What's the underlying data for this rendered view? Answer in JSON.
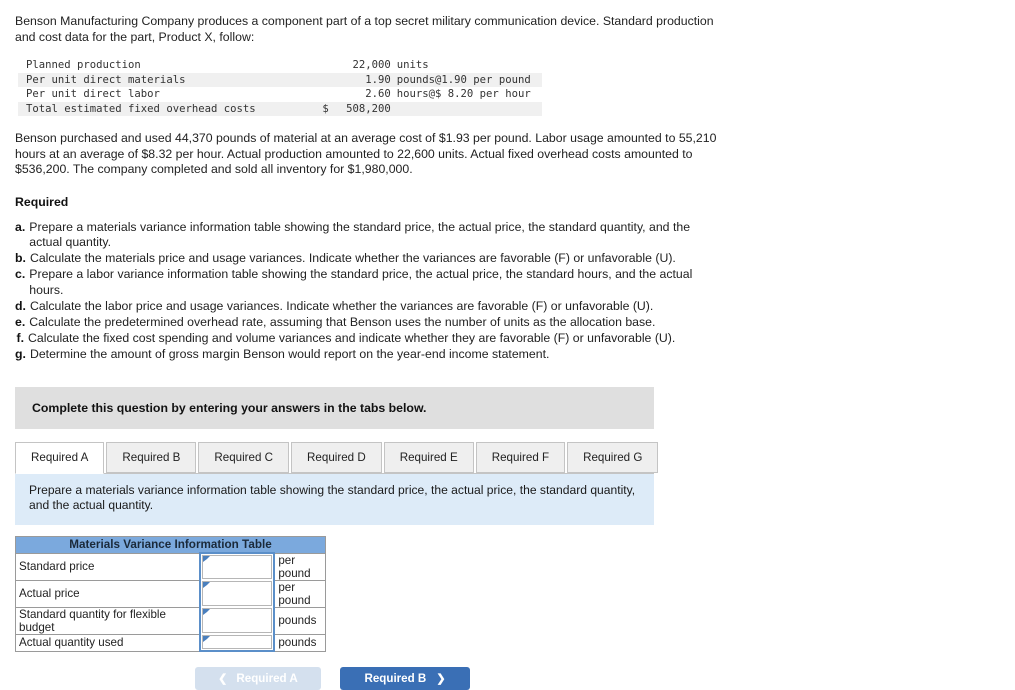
{
  "intro": {
    "paragraph1": "Benson Manufacturing Company produces a component part of a top secret military communication device. Standard production and cost data for the part, Product X, follow:",
    "paragraph2": "Benson purchased and used 44,370 pounds of material at an average cost of $1.93 per pound. Labor usage amounted to 55,210 hours at an average of $8.32 per hour. Actual production amounted to 22,600 units. Actual fixed overhead costs amounted to $536,200. The company completed and sold all inventory for $1,980,000."
  },
  "data_table": {
    "rows": [
      {
        "label": "Planned production",
        "dollar": "",
        "value": "22,000",
        "unit": "units"
      },
      {
        "label": "Per unit direct materials",
        "dollar": "",
        "value": "1.90",
        "unit": "pounds@1.90 per pound"
      },
      {
        "label": "Per unit direct labor",
        "dollar": "",
        "value": "2.60",
        "unit": "hours@$ 8.20 per hour"
      },
      {
        "label": "Total estimated fixed overhead costs",
        "dollar": "$",
        "value": "508,200",
        "unit": ""
      }
    ]
  },
  "required": {
    "heading": "Required",
    "items": [
      {
        "letter": "a.",
        "text": "Prepare a materials variance information table showing the standard price, the actual price, the standard quantity, and the actual quantity."
      },
      {
        "letter": "b.",
        "text": "Calculate the materials price and usage variances. Indicate whether the variances are favorable (F) or unfavorable (U)."
      },
      {
        "letter": "c.",
        "text": "Prepare a labor variance information table showing the standard price, the actual price, the standard hours, and the actual hours."
      },
      {
        "letter": "d.",
        "text": "Calculate the labor price and usage variances. Indicate whether the variances are favorable (F) or unfavorable (U)."
      },
      {
        "letter": "e.",
        "text": "Calculate the predetermined overhead rate, assuming that Benson uses the number of units as the allocation base."
      },
      {
        "letter": "f.",
        "text": "Calculate the fixed cost spending and volume variances and indicate whether they are favorable (F) or unfavorable (U)."
      },
      {
        "letter": "g.",
        "text": "Determine the amount of gross margin Benson would report on the year-end income statement."
      }
    ]
  },
  "banner": {
    "text": "Complete this question by entering your answers in the tabs below."
  },
  "tabs": [
    {
      "label": "Required A",
      "active": true
    },
    {
      "label": "Required B",
      "active": false
    },
    {
      "label": "Required C",
      "active": false
    },
    {
      "label": "Required D",
      "active": false
    },
    {
      "label": "Required E",
      "active": false
    },
    {
      "label": "Required F",
      "active": false
    },
    {
      "label": "Required G",
      "active": false
    }
  ],
  "instruction": {
    "text": "Prepare a materials variance information table showing the standard price, the actual price, the standard quantity, and the actual quantity."
  },
  "answer_table": {
    "title": "Materials Variance Information Table",
    "rows": [
      {
        "label": "Standard price",
        "value": "",
        "unit": "per pound"
      },
      {
        "label": "Actual price",
        "value": "",
        "unit": "per pound"
      },
      {
        "label": "Standard quantity for flexible budget",
        "value": "",
        "unit": "pounds"
      },
      {
        "label": "Actual quantity used",
        "value": "",
        "unit": "pounds"
      }
    ]
  },
  "nav": {
    "prev_label": "Required A",
    "next_label": "Required B",
    "prev_chevron": "❮",
    "next_chevron": "❯"
  },
  "colors": {
    "table_header_blue": "#7ba9dd",
    "instruction_blue": "#ddebf8",
    "banner_gray": "#dfdfdf",
    "next_button_blue": "#3a6fb5",
    "prev_button_blue": "#d4e0ee",
    "input_border_blue": "#5b8fc9"
  }
}
